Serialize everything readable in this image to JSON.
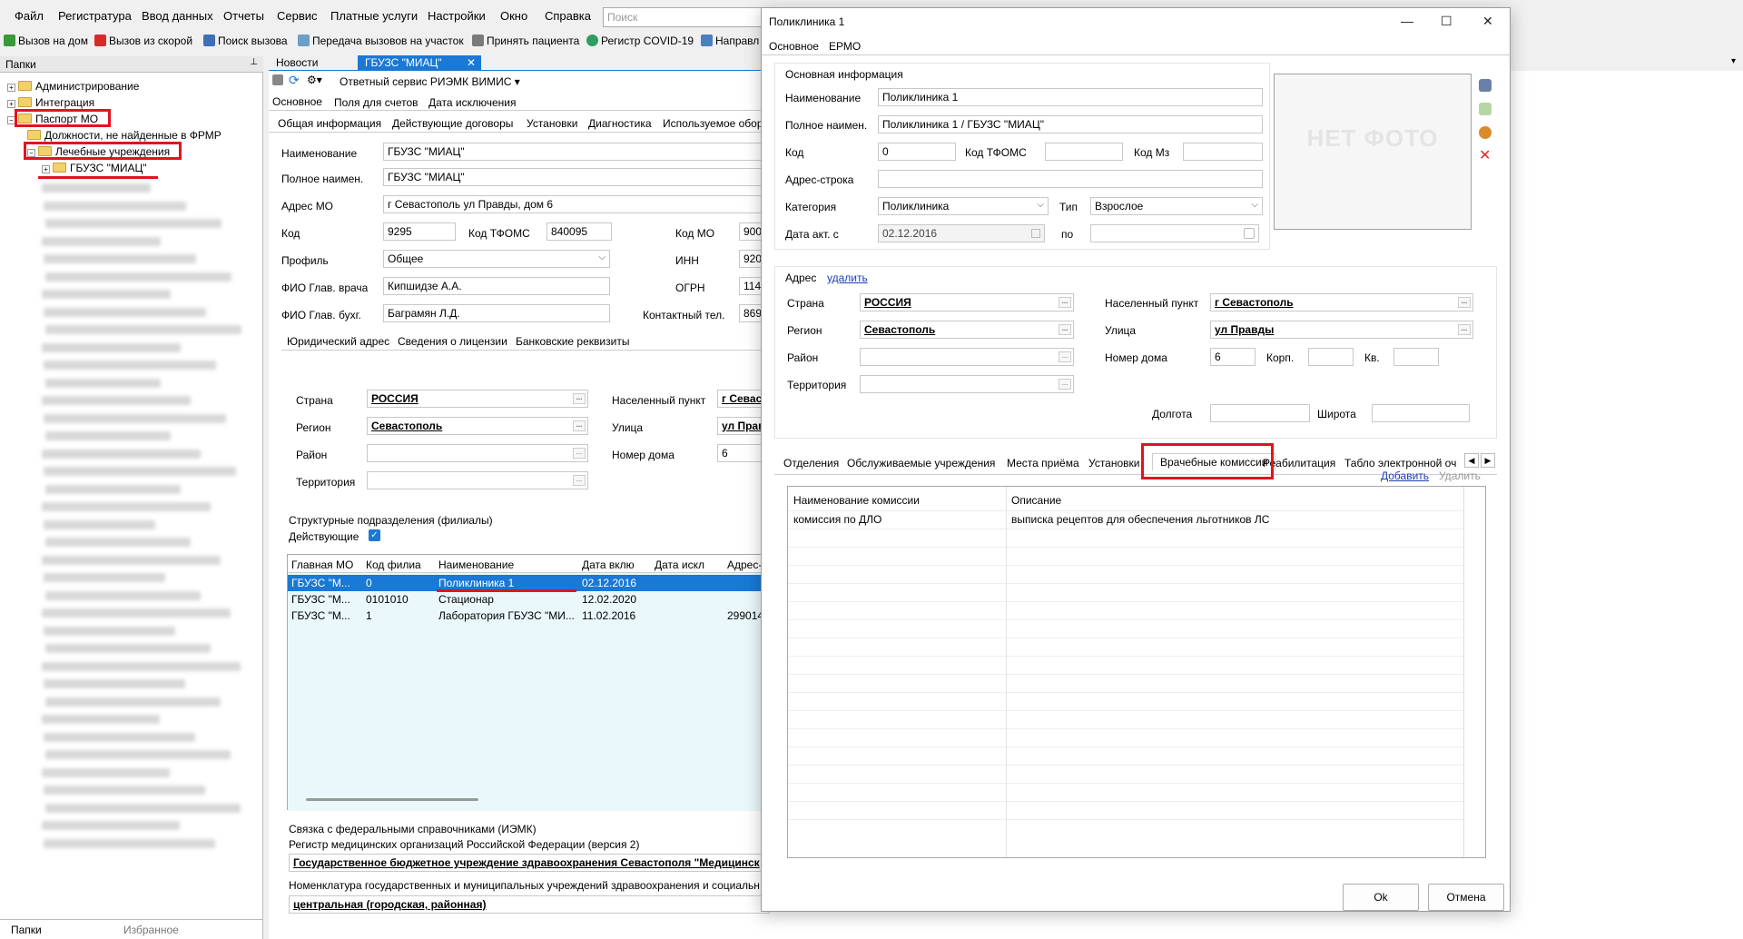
{
  "menu": [
    "Файл",
    "Регистратура",
    "Ввод данных",
    "Отчеты",
    "Сервис",
    "Платные услуги",
    "Настройки",
    "Окно",
    "Справка"
  ],
  "search": {
    "placeholder": "Поиск"
  },
  "toolbar": {
    "home_visit": "Вызов на дом",
    "ambulance": "Вызов из скорой",
    "call_search": "Поиск вызова",
    "transfer": "Передача вызовов на участок",
    "accept_patient": "Принять пациента",
    "covid": "Регистр COVID-19",
    "direction": "Направл"
  },
  "left": {
    "header": "Папки",
    "tree": {
      "admin": "Администрирование",
      "integration": "Интеграция",
      "passport": "Паспорт МО",
      "positions": "Должности, не найденные в ФРМР",
      "hospitals": "Лечебные учреждения",
      "org": "ГБУЗС \"МИАЦ\""
    },
    "bottom_tabs": [
      "Папки",
      "Избранное"
    ]
  },
  "doc_tabs": {
    "news": "Новости",
    "org": "ГБУЗС \"МИАЦ\""
  },
  "main": {
    "service": "Ответный сервис РИЭМК ВИМИС",
    "top_tabs": [
      "Основное",
      "Поля для счетов",
      "Дата исключения"
    ],
    "sub_tabs": [
      "Общая информация",
      "Действующие договоры",
      "Установки",
      "Диагностика",
      "Используемое обор"
    ],
    "name_label": "Наименование",
    "name_value": "ГБУЗС \"МИАЦ\"",
    "fullname_label": "Полное наимен.",
    "fullname_value": "ГБУЗС \"МИАЦ\"",
    "address_label": "Адрес МО",
    "address_value": "г Севастополь  ул Правды, дом 6",
    "code_label": "Код",
    "code_value": "9295",
    "tfoms_label": "Код ТФОМС",
    "tfoms_value": "840095",
    "kodmo_label": "Код МО",
    "kodmo_value": "900",
    "profile_label": "Профиль",
    "profile_value": "Общее",
    "inn_label": "ИНН",
    "inn_value": "920",
    "chief_label": "ФИО Глав. врача",
    "chief_value": "Кипшидзе А.А.",
    "ogrn_label": "ОГРН",
    "ogrn_value": "114",
    "accountant_label": "ФИО Глав. бухг.",
    "accountant_value": "Баграмян Л.Д.",
    "phone_label": "Контактный тел.",
    "phone_value": "869",
    "addr_tabs": [
      "Юридический адрес",
      "Сведения о лицензии",
      "Банковские реквизиты"
    ],
    "country_label": "Страна",
    "country_value": "РОССИЯ",
    "region_label": "Регион",
    "region_value": "Севастополь",
    "district_label": "Район",
    "territory_label": "Территория",
    "city_label": "Населенный пункт",
    "city_value": "г Севас",
    "street_label": "Улица",
    "street_value": "ул Прав",
    "house_label": "Номер дома",
    "house_value": "6",
    "branches_title": "Структурные подразделения (филиалы)",
    "active_label": "Действующие",
    "table_headers": [
      "Главная МО",
      "Код филиа",
      "Наименование",
      "Дата вклю",
      "Дата искл",
      "Адрес-"
    ],
    "rows": [
      [
        "ГБУЗС \"М...",
        "0",
        "Поликлиника 1",
        "02.12.2016",
        "",
        ""
      ],
      [
        "ГБУЗС \"М...",
        "0101010",
        "Стационар",
        "12.02.2020",
        "",
        ""
      ],
      [
        "ГБУЗС \"М...",
        "1",
        "Лаборатория ГБУЗС \"МИ...",
        "11.02.2016",
        "",
        "299014,"
      ]
    ],
    "fed_title": "Связка с федеральными справочниками (ИЭМК)",
    "fed_reg": "Регистр медицинских организаций Российской Федерации (версия 2)",
    "fed_reg_value": "Государственное бюджетное учреждение здравоохранения Севастополя \"Медицинск",
    "fed_nom": "Номенклатура государственных и муниципальных учреждений здравоохранения и социальн",
    "fed_nom_value": "центральная (городская, районная)"
  },
  "dialog": {
    "title": "Поликлиника 1",
    "tabs": [
      "Основное",
      "ЕРМО"
    ],
    "section": "Основная информация",
    "name_label": "Наименование",
    "name_value": "Поликлиника 1",
    "fullname_label": "Полное наимен.",
    "fullname_value": "Поликлиника 1 / ГБУЗС \"МИАЦ\"",
    "code_label": "Код",
    "code_value": "0",
    "tfoms_label": "Код ТФОМС",
    "mz_label": "Код Мз",
    "address_string_label": "Адрес-строка",
    "category_label": "Категория",
    "category_value": "Поликлиника",
    "type_label": "Тип",
    "type_value": "Взрослое",
    "date_label": "Дата акт. с",
    "date_value": "02.12.2016",
    "to_label": "по",
    "photo": "НЕТ ФОТО",
    "address_title": "Адрес",
    "delete_addr": "удалить",
    "country_label": "Страна",
    "country_value": "РОССИЯ",
    "region_label": "Регион",
    "region_value": "Севастополь",
    "district_label": "Район",
    "territory_label": "Территория",
    "city_label": "Населенный пункт",
    "city_value": "г Севастополь",
    "street_label": "Улица",
    "street_value": "ул Правды",
    "house_label": "Номер дома",
    "house_value": "6",
    "corp_label": "Корп.",
    "apt_label": "Кв.",
    "lon_label": "Долгота",
    "lat_label": "Широта",
    "bottom_tabs": [
      "Отделения",
      "Обслуживаемые учреждения",
      "Места приёма",
      "Установки",
      "Врачебные комиссии",
      "Реабилитация",
      "Табло электронной оч"
    ],
    "add": "Добавить",
    "remove": "Удалить",
    "comm_headers": [
      "Наименование комиссии",
      "Описание"
    ],
    "comm_rows": [
      [
        "комиссия по ДЛО",
        "выписка рецептов для обеспечения льготников ЛС"
      ]
    ],
    "ok": "Ok",
    "cancel": "Отмена"
  }
}
